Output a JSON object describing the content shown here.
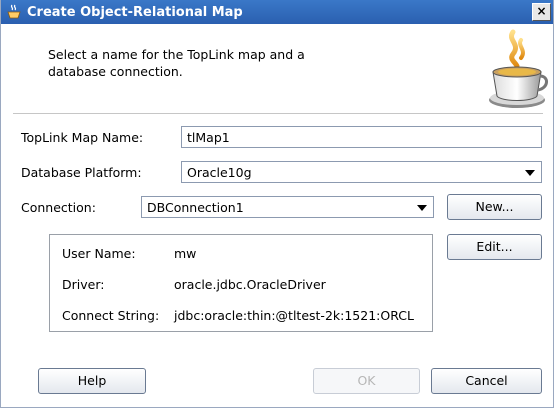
{
  "window": {
    "title": "Create Object-Relational Map",
    "close_label": "×"
  },
  "header": {
    "description": "Select a name for the TopLink map and a database connection."
  },
  "form": {
    "map_name_label": "TopLink Map Name:",
    "map_name_value": "tlMap1",
    "platform_label": "Database Platform:",
    "platform_value": "Oracle10g",
    "connection_label": "Connection:",
    "connection_value": "DBConnection1"
  },
  "buttons": {
    "new": "New...",
    "edit": "Edit...",
    "help": "Help",
    "ok": "OK",
    "cancel": "Cancel"
  },
  "connection_info": {
    "user_name_label": "User Name:",
    "user_name_value": "mw",
    "driver_label": "Driver:",
    "driver_value": "oracle.jdbc.OracleDriver",
    "connect_string_label": "Connect String:",
    "connect_string_value": "jdbc:oracle:thin:@tltest-2k:1521:ORCL"
  },
  "icons": {
    "title_icon": "coffee-cup-icon",
    "header_icon": "coffee-cup-icon"
  }
}
